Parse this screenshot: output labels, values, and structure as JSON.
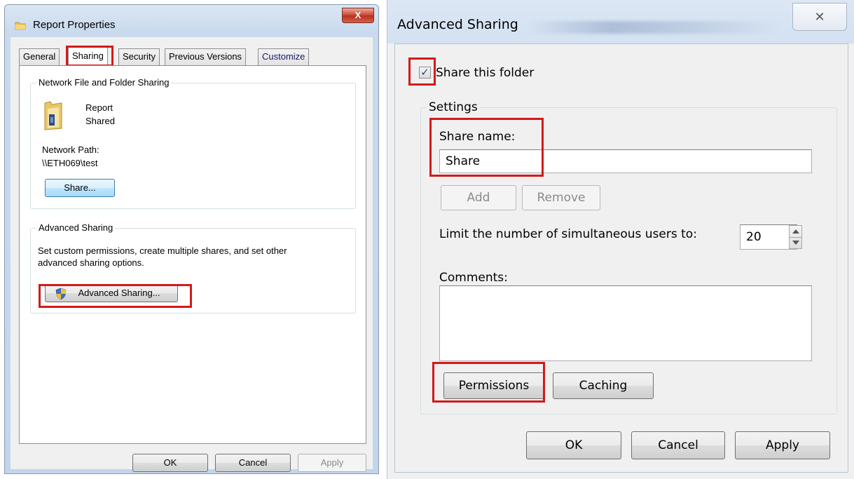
{
  "left_dialog": {
    "title": "Report Properties",
    "close_glyph": "X",
    "tabs": [
      "General",
      "Sharing",
      "Security",
      "Previous Versions",
      "Customize"
    ],
    "active_tab": "Sharing",
    "network_sharing": {
      "legend": "Network File and Folder Sharing",
      "folder_name": "Report",
      "folder_status": "Shared",
      "network_path_label": "Network Path:",
      "network_path": "\\\\ETH069\\test",
      "share_button": "Share..."
    },
    "advanced_sharing": {
      "legend": "Advanced Sharing",
      "description_line1": "Set custom permissions, create multiple shares, and set other",
      "description_line2": "advanced sharing options.",
      "button": "Advanced Sharing..."
    },
    "footer": {
      "ok": "OK",
      "cancel": "Cancel",
      "apply": "Apply"
    }
  },
  "right_dialog": {
    "title": "Advanced Sharing",
    "close_glyph": "✕",
    "share_checkbox_label": "Share this folder",
    "share_checked": true,
    "settings": {
      "legend": "Settings",
      "share_name_label": "Share name:",
      "share_name_value": "Share",
      "add_button": "Add",
      "remove_button": "Remove",
      "limit_label": "Limit the number of simultaneous users to:",
      "limit_value": "20",
      "comments_label": "Comments:",
      "comments_value": "",
      "permissions_button": "Permissions",
      "caching_button": "Caching"
    },
    "footer": {
      "ok": "OK",
      "cancel": "Cancel",
      "apply": "Apply"
    }
  },
  "colors": {
    "highlight_box": "#d21a1a",
    "title_bar": "#c9daee",
    "close_button": "#c9452f"
  }
}
